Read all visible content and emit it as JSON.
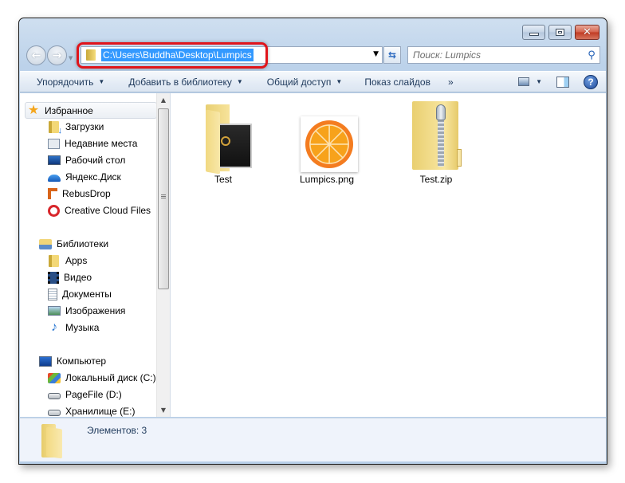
{
  "window": {
    "controls": {
      "minimize": "minimize",
      "maximize": "maximize",
      "close": "✕"
    }
  },
  "navigation": {
    "back_glyph": "←",
    "forward_glyph": "→",
    "address": "C:\\Users\\Buddha\\Desktop\\Lumpics",
    "address_highlighted": true,
    "refresh_glyph": "⇆",
    "search_placeholder": "Поиск: Lumpics"
  },
  "toolbar": {
    "organize": "Упорядочить",
    "add_to_library": "Добавить в библиотеку",
    "share": "Общий доступ",
    "slideshow": "Показ слайдов",
    "more": "»",
    "help": "?"
  },
  "sidebar": {
    "favorites": {
      "label": "Избранное",
      "items": [
        {
          "label": "Загрузки",
          "icon": "downloads-folder-icon"
        },
        {
          "label": "Недавние места",
          "icon": "recent-places-icon"
        },
        {
          "label": "Рабочий стол",
          "icon": "desktop-icon"
        },
        {
          "label": "Яндекс.Диск",
          "icon": "yandex-disk-icon"
        },
        {
          "label": "RebusDrop",
          "icon": "rebusdrop-icon"
        },
        {
          "label": "Creative Cloud Files",
          "icon": "creative-cloud-icon"
        }
      ]
    },
    "libraries": {
      "label": "Библиотеки",
      "items": [
        {
          "label": "Apps",
          "icon": "folder-icon"
        },
        {
          "label": "Видео",
          "icon": "video-library-icon"
        },
        {
          "label": "Документы",
          "icon": "documents-library-icon"
        },
        {
          "label": "Изображения",
          "icon": "pictures-library-icon"
        },
        {
          "label": "Музыка",
          "icon": "music-library-icon"
        }
      ]
    },
    "computer": {
      "label": "Компьютер",
      "items": [
        {
          "label": "Локальный диск (C:)",
          "icon": "system-drive-icon"
        },
        {
          "label": "PageFile (D:)",
          "icon": "drive-icon"
        },
        {
          "label": "Хранилище (E:)",
          "icon": "drive-icon"
        }
      ]
    }
  },
  "files": [
    {
      "name": "Test",
      "type": "folder"
    },
    {
      "name": "Lumpics.png",
      "type": "image"
    },
    {
      "name": "Test.zip",
      "type": "zip"
    }
  ],
  "status": {
    "item_count": "Элементов: 3"
  },
  "colors": {
    "highlight_border": "#e0141b",
    "selection": "#3399ff",
    "orange_fill": "#f7a21b",
    "orange_rim": "#f47c20"
  }
}
